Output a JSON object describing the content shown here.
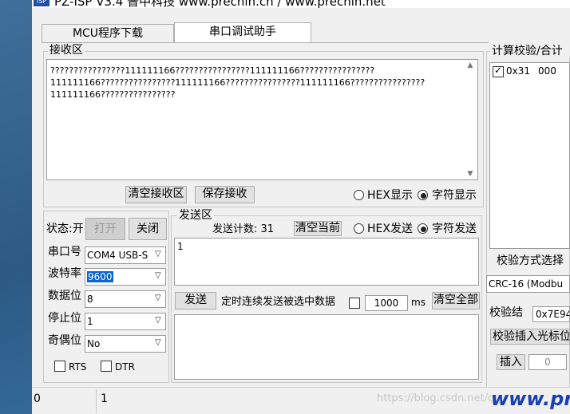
{
  "title": "PZ-ISP V3.4 普中科技 www.prechin.cn / www.prechin.net",
  "tabs": [
    {
      "label": "MCU程序下载"
    },
    {
      "label": "串口调试助手"
    }
  ],
  "receive": {
    "group_label": "接收区",
    "lines": [
      "????????????????111111166????????????????111111166????????????????",
      "111111166????????????????111111166????????????????111111166????????????????",
      "111111166????????????????"
    ],
    "clear_button": "清空接收区",
    "save_button": "保存接收",
    "hex_display": "HEX显示",
    "char_display": "字符显示"
  },
  "serial": {
    "status_label": "状态:开",
    "open_button": "打开",
    "close_button": "关闭",
    "port_label": "串口号",
    "port_value": "COM4  USB-S",
    "baud_label": "波特率",
    "baud_value": "9600",
    "databits_label": "数据位",
    "databits_value": "8",
    "stopbits_label": "停止位",
    "stopbits_value": "1",
    "parity_label": "奇偶位",
    "parity_value": "No",
    "rts_label": "RTS",
    "dtr_label": "DTR"
  },
  "send": {
    "group_label": "发送区",
    "count_label": "发送计数: 31",
    "clear_current_button": "清空当前",
    "hex_send": "HEX发送",
    "char_send": "字符发送",
    "content": "1",
    "send_button": "发送",
    "timed_label": "定时连续发送被选中数据",
    "interval_value": "1000",
    "interval_unit": "ms",
    "clear_all_button": "清空全部"
  },
  "checksum": {
    "group_label": "计算校验/合计",
    "item_hex": "0x31",
    "item_val": "000",
    "method_label": "校验方式选择",
    "method_value": "CRC-16 (Modbu",
    "result_label": "校验结",
    "result_value": "0x7E94",
    "insert_cursor_label": "校验插入光标位",
    "insert_label": "插入",
    "insert_value": "0"
  },
  "statusbar": {
    "left_value": "0",
    "right_value": "1",
    "watermark": "https://blog.csdn.net/qq_",
    "brand": "www.pr"
  }
}
